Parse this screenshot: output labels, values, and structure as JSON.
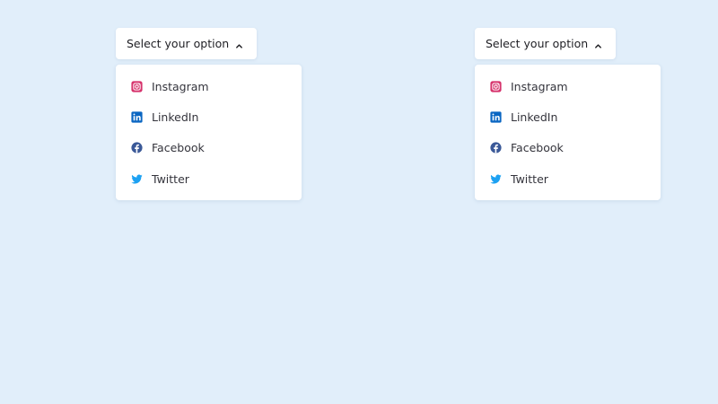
{
  "dropdowns": [
    {
      "button_label": "Select your option",
      "items": [
        {
          "label": "Instagram",
          "icon": "instagram-icon",
          "color": "#d6336c"
        },
        {
          "label": "LinkedIn",
          "icon": "linkedin-icon",
          "color": "#0a66c2"
        },
        {
          "label": "Facebook",
          "icon": "facebook-icon",
          "color": "#3b5998"
        },
        {
          "label": "Twitter",
          "icon": "twitter-icon",
          "color": "#1da1f2"
        }
      ]
    },
    {
      "button_label": "Select your option",
      "items": [
        {
          "label": "Instagram",
          "icon": "instagram-icon",
          "color": "#d6336c"
        },
        {
          "label": "LinkedIn",
          "icon": "linkedin-icon",
          "color": "#0a66c2"
        },
        {
          "label": "Facebook",
          "icon": "facebook-icon",
          "color": "#3b5998"
        },
        {
          "label": "Twitter",
          "icon": "twitter-icon",
          "color": "#1da1f2"
        }
      ]
    }
  ],
  "colors": {
    "background": "#e1eefa",
    "panel": "#ffffff",
    "text": "#34343c"
  }
}
